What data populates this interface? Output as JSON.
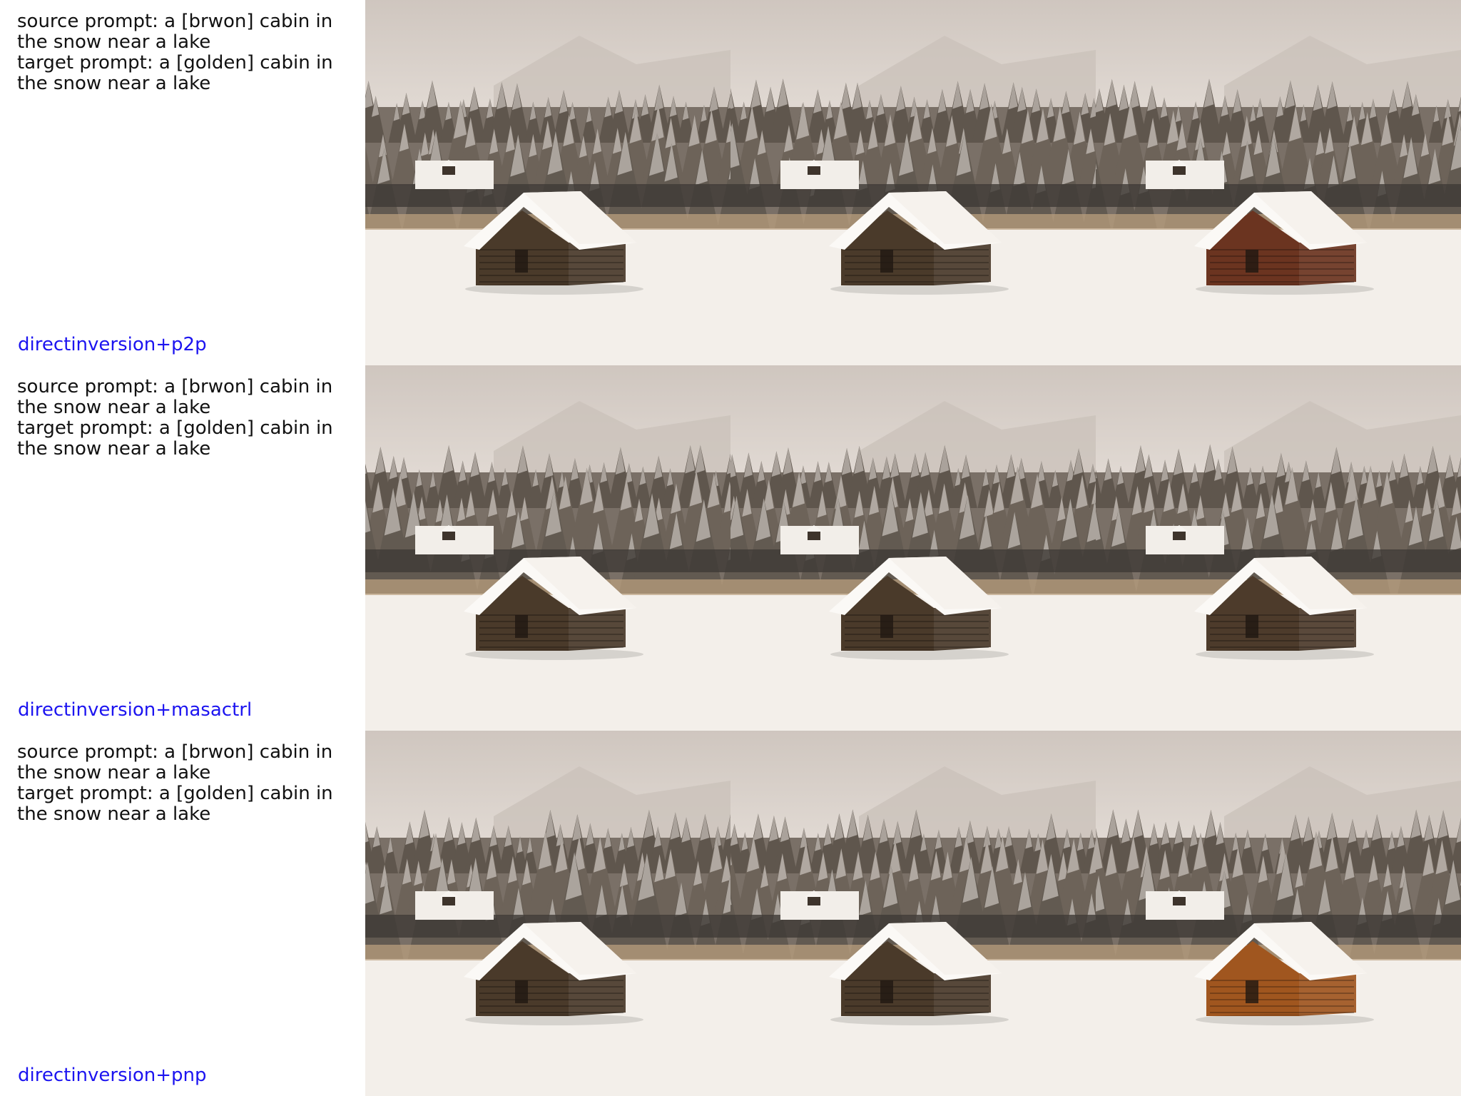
{
  "rows": [
    {
      "source_prompt": "source prompt: a [brwon] cabin in the snow near a lake",
      "target_prompt": "target prompt: a [golden] cabin in the snow near a lake",
      "method": "directinversion+p2p",
      "images": [
        {
          "cabin_color": "#4a3a2a"
        },
        {
          "cabin_color": "#4a3a2a"
        },
        {
          "cabin_color": "#6b3420"
        }
      ]
    },
    {
      "source_prompt": "source prompt: a [brwon] cabin in the snow near a lake",
      "target_prompt": "target prompt: a [golden] cabin in the snow near a lake",
      "method": "directinversion+masactrl",
      "images": [
        {
          "cabin_color": "#4a3a2a"
        },
        {
          "cabin_color": "#4a3a2a"
        },
        {
          "cabin_color": "#4d3b2b"
        }
      ]
    },
    {
      "source_prompt": "source prompt: a [brwon] cabin in the snow near a lake",
      "target_prompt": "target prompt: a [golden] cabin in the snow near a lake",
      "method": "directinversion+pnp",
      "images": [
        {
          "cabin_color": "#4a3a2a"
        },
        {
          "cabin_color": "#4a3a2a"
        },
        {
          "cabin_color": "#a0561f"
        }
      ]
    }
  ],
  "colors": {
    "method_label": "#1c14f0",
    "prompt_text": "#111111",
    "sky": "#d9d2cc",
    "snow": "#f3efea",
    "forest": "#6f675e"
  }
}
